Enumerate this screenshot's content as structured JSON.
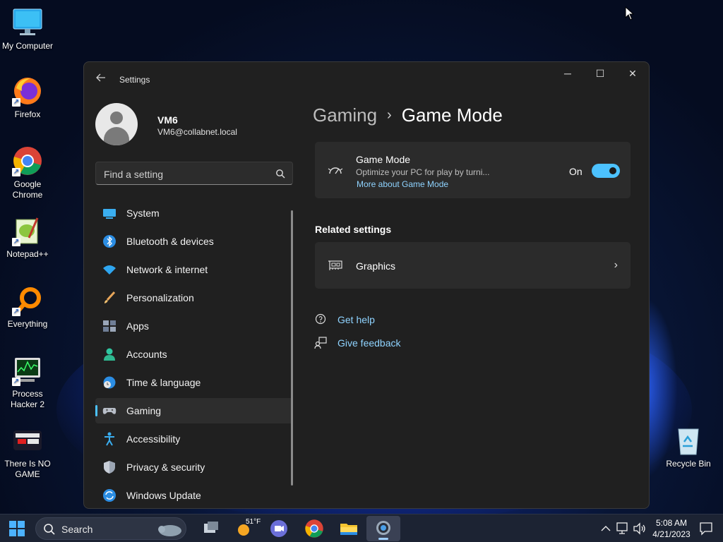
{
  "desktop": {
    "icons": [
      {
        "label": "My Computer",
        "icon": "computer-icon"
      },
      {
        "label": "Firefox",
        "icon": "firefox-icon"
      },
      {
        "label": "Google Chrome",
        "icon": "chrome-icon"
      },
      {
        "label": "Notepad++",
        "icon": "notepad-plus-plus-icon"
      },
      {
        "label": "Everything",
        "icon": "everything-search-icon"
      },
      {
        "label": "Process Hacker 2",
        "icon": "process-hacker-icon"
      },
      {
        "label": "There Is NO GAME",
        "icon": "there-is-no-game-icon"
      },
      {
        "label": "Recycle Bin",
        "icon": "recycle-bin-icon"
      }
    ]
  },
  "window": {
    "title": "Settings",
    "controls": {
      "minimize": "─",
      "maximize": "☐",
      "close": "✕"
    }
  },
  "profile": {
    "name": "VM6",
    "email": "VM6@collabnet.local"
  },
  "search": {
    "placeholder": "Find a setting"
  },
  "nav": {
    "items": [
      {
        "label": "System",
        "icon": "system-icon",
        "active": false
      },
      {
        "label": "Bluetooth & devices",
        "icon": "bluetooth-icon",
        "active": false
      },
      {
        "label": "Network & internet",
        "icon": "wifi-icon",
        "active": false
      },
      {
        "label": "Personalization",
        "icon": "brush-icon",
        "active": false
      },
      {
        "label": "Apps",
        "icon": "apps-icon",
        "active": false
      },
      {
        "label": "Accounts",
        "icon": "accounts-icon",
        "active": false
      },
      {
        "label": "Time & language",
        "icon": "globe-clock-icon",
        "active": false
      },
      {
        "label": "Gaming",
        "icon": "gamepad-icon",
        "active": true
      },
      {
        "label": "Accessibility",
        "icon": "accessibility-icon",
        "active": false
      },
      {
        "label": "Privacy & security",
        "icon": "shield-icon",
        "active": false
      },
      {
        "label": "Windows Update",
        "icon": "update-icon",
        "active": false
      }
    ]
  },
  "breadcrumb": {
    "parent": "Gaming",
    "separator": "›",
    "current": "Game Mode"
  },
  "game_mode": {
    "title": "Game Mode",
    "description": "Optimize your PC for play by turni...",
    "link": "More about Game Mode",
    "state_label": "On",
    "enabled": true
  },
  "related": {
    "heading": "Related settings",
    "items": [
      {
        "label": "Graphics",
        "icon": "graphics-card-icon"
      }
    ]
  },
  "help_links": [
    {
      "label": "Get help",
      "icon": "get-help-icon"
    },
    {
      "label": "Give feedback",
      "icon": "feedback-icon"
    }
  ],
  "taskbar": {
    "search_label": "Search",
    "weather_temp": "51°F",
    "time": "5:08 AM",
    "date": "4/21/2023"
  },
  "colors": {
    "accent": "#4cc2ff",
    "window_bg": "#202020",
    "card_bg": "#2b2b2b"
  }
}
